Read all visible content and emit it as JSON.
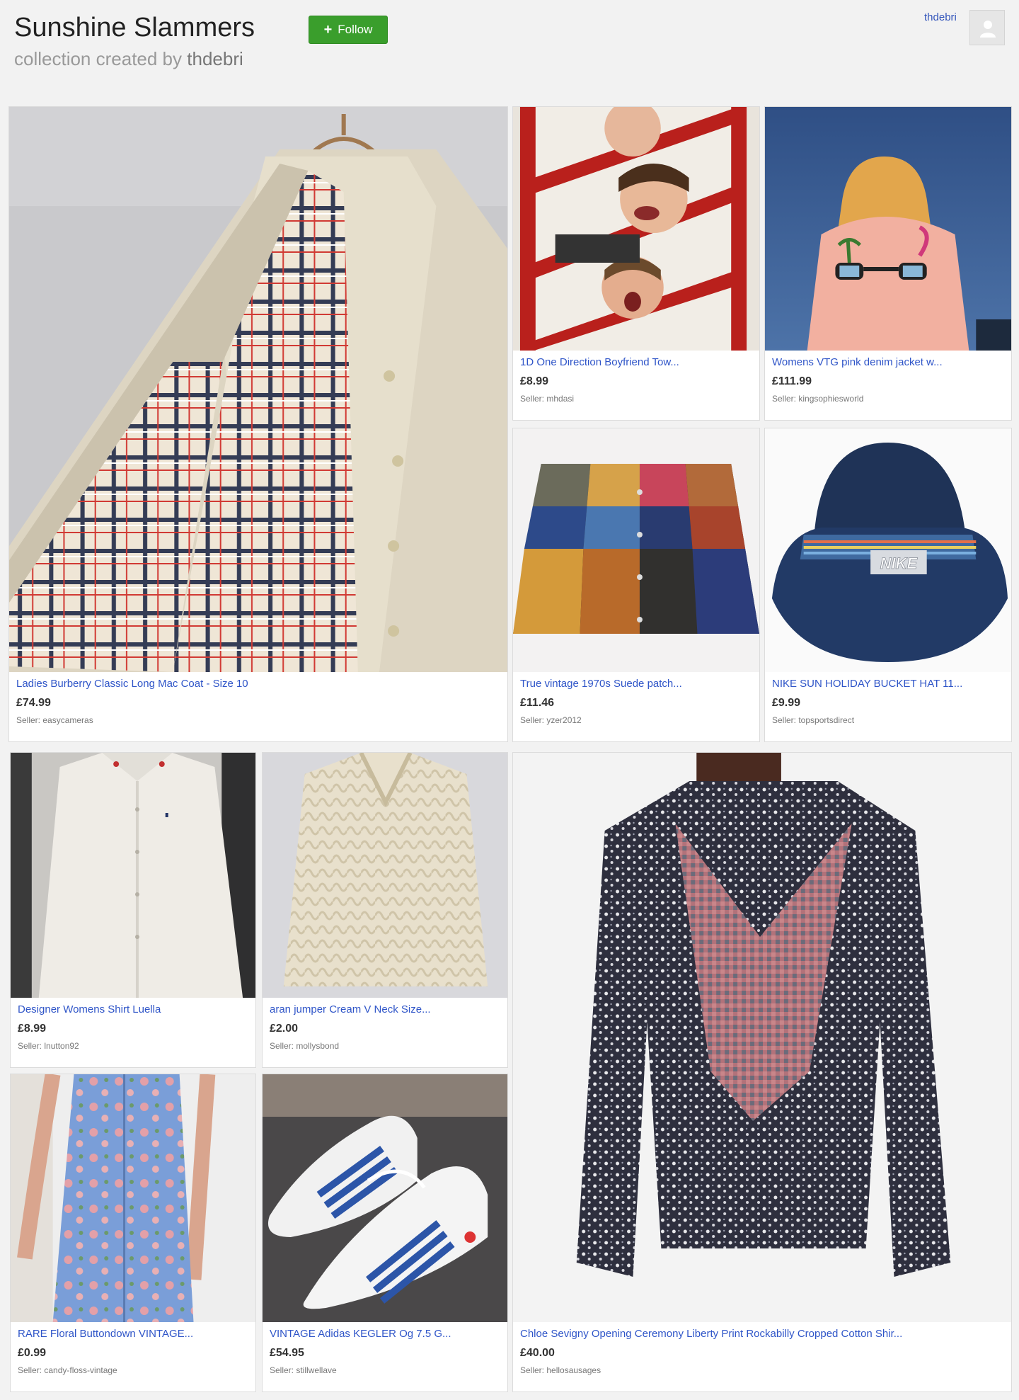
{
  "header": {
    "title": "Sunshine Slammers",
    "subtitle_prefix": "collection created by",
    "subtitle_user": "thdebri",
    "follow_label": "Follow",
    "user_link": "thdebri"
  },
  "items": [
    {
      "title": "Ladies Burberry Classic Long Mac Coat - Size 10",
      "price": "£74.99",
      "seller": "Seller: easycameras"
    },
    {
      "title": "1D One Direction Boyfriend Tow...",
      "price": "£8.99",
      "seller": "Seller: mhdasi"
    },
    {
      "title": "Womens VTG pink denim jacket w...",
      "price": "£111.99",
      "seller": "Seller: kingsophiesworld"
    },
    {
      "title": "True vintage 1970s Suede patch...",
      "price": "£11.46",
      "seller": "Seller: yzer2012"
    },
    {
      "title": "NIKE SUN HOLIDAY BUCKET HAT 11...",
      "price": "£9.99",
      "seller": "Seller: topsportsdirect"
    },
    {
      "title": "Designer Womens Shirt Luella",
      "price": "£8.99",
      "seller": "Seller: lnutton92"
    },
    {
      "title": "aran jumper Cream V Neck Size...",
      "price": "£2.00",
      "seller": "Seller: mollysbond"
    },
    {
      "title": "Chloe Sevigny Opening Ceremony Liberty Print Rockabilly Cropped Cotton Shir...",
      "price": "£40.00",
      "seller": "Seller: hellosausages"
    },
    {
      "title": "RARE Floral Buttondown VINTAGE...",
      "price": "£0.99",
      "seller": "Seller: candy-floss-vintage"
    },
    {
      "title": "VINTAGE Adidas KEGLER Og 7.5 G...",
      "price": "£54.95",
      "seller": "Seller: stillwellave"
    }
  ],
  "image_text": {
    "hat_brand": "NIKE"
  }
}
